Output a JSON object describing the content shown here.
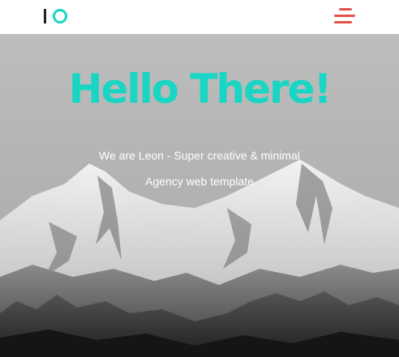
{
  "header": {
    "logo_icon": "io-logo-icon",
    "menu_icon": "hamburger-menu-icon",
    "accent_color": "#18d6c3",
    "menu_color": "#e0534a"
  },
  "hero": {
    "title": "Hello There!",
    "subtitle_line1": "We are Leon - Super creative & minimal",
    "subtitle_line2": "Agency web template",
    "background": "mountain-landscape-image"
  }
}
